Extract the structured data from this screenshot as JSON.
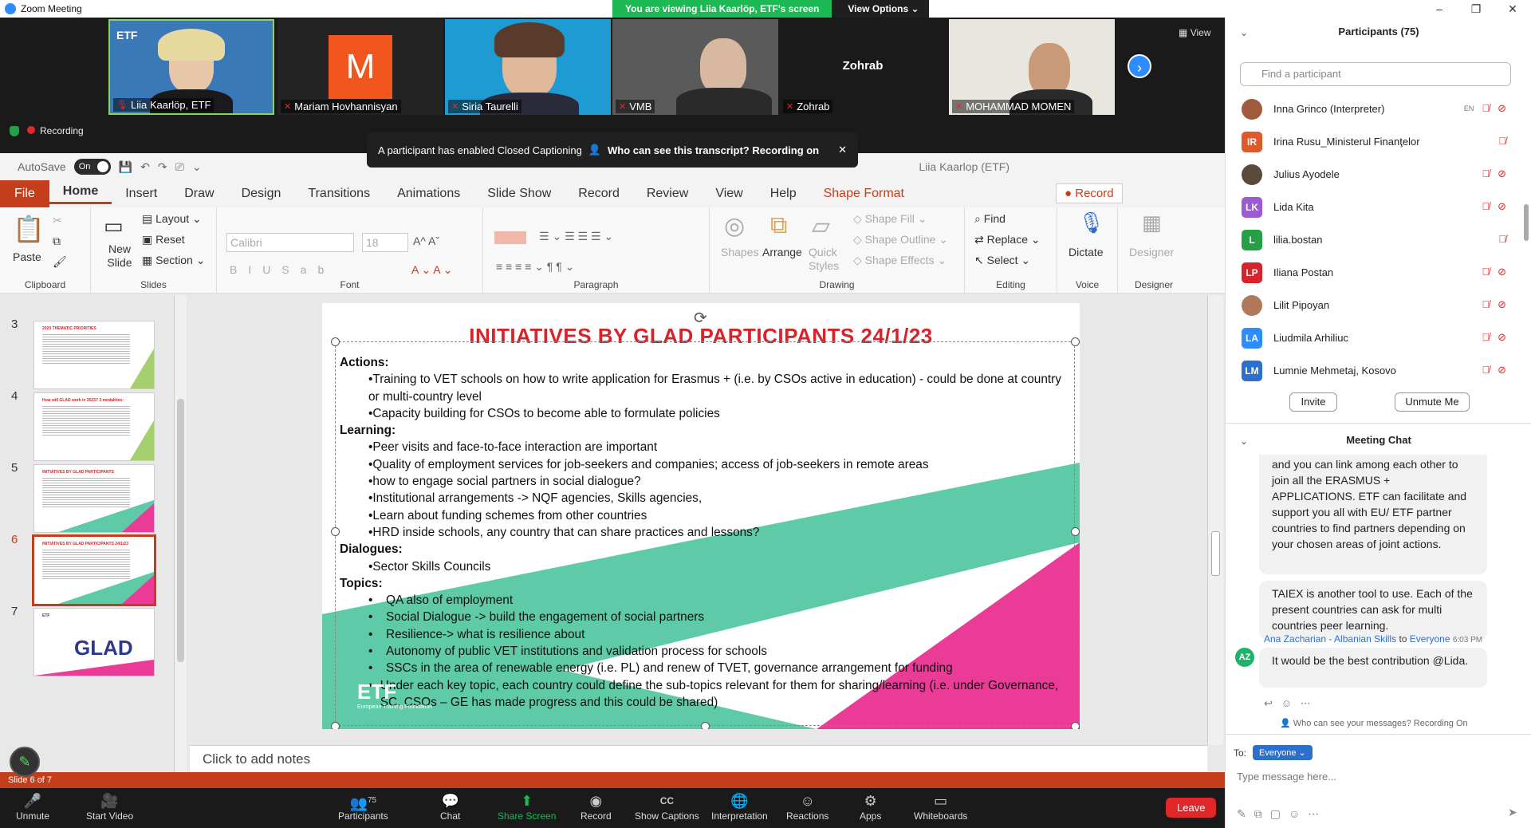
{
  "window": {
    "title": "Zoom Meeting",
    "viewing_banner": "You are viewing Liia Kaarlöp, ETF's screen",
    "view_options": "View Options",
    "minimize": "–",
    "maximize": "❐",
    "close": "✕"
  },
  "video": {
    "tiles": [
      {
        "name": "Liia Kaarlöp, ETF",
        "type": "video"
      },
      {
        "name": "Mariam Hovhannisyan",
        "type": "avatar",
        "initial": "M"
      },
      {
        "name": "Siria Taurelli",
        "type": "video"
      },
      {
        "name": "VMB",
        "type": "video"
      },
      {
        "name": "Zohrab",
        "type": "name",
        "center_label": "Zohrab"
      },
      {
        "name": "MOHAMMAD MOMEN",
        "type": "video"
      }
    ],
    "view_label": "View",
    "recording_label": "Recording"
  },
  "cc_banner": {
    "text": "A participant has enabled Closed Captioning",
    "question": "Who can see this transcript? Recording on"
  },
  "ppt": {
    "autosave_label": "AutoSave",
    "autosave_state": "On",
    "user": "Liia Kaarlop (ETF)",
    "tabs": [
      "Home",
      "Insert",
      "Draw",
      "Design",
      "Transitions",
      "Animations",
      "Slide Show",
      "Record",
      "Review",
      "View",
      "Help"
    ],
    "file_tab": "File",
    "shape_format_tab": "Shape Format",
    "record_button": "Record",
    "ribbon": {
      "paste": "Paste",
      "clipboard": "Clipboard",
      "new_slide": "New Slide",
      "layout": "Layout",
      "reset": "Reset",
      "section": "Section",
      "slides": "Slides",
      "font_name": "Calibri",
      "font_size": "18",
      "font": "Font",
      "paragraph": "Paragraph",
      "shapes": "Shapes",
      "arrange": "Arrange",
      "quick_styles": "Quick Styles",
      "shape_fill": "Shape Fill",
      "shape_outline": "Shape Outline",
      "shape_effects": "Shape Effects",
      "drawing": "Drawing",
      "find": "Find",
      "replace": "Replace",
      "select": "Select",
      "editing": "Editing",
      "dictate": "Dictate",
      "voice": "Voice",
      "designer": "Designer",
      "designer_group": "Designer"
    },
    "thumbnails": [
      {
        "num": "3",
        "title": "2023 THEMATIC PRIORITIES"
      },
      {
        "num": "4",
        "title": "How will GLAD work in 2023? 3 modalities:"
      },
      {
        "num": "5",
        "title": "INITIATIVES BY GLAD PARTICIPANTS"
      },
      {
        "num": "6",
        "title": "INITIATIVES BY GLAD PARTICIPANTS 24/1/23"
      },
      {
        "num": "7",
        "title": "GLAD"
      }
    ],
    "slide": {
      "title": "INITIATIVES BY GLAD PARTICIPANTS 24/1/23",
      "sections": [
        {
          "header": "Actions:",
          "style": "dot",
          "items": [
            "•Training to VET schools on how to write application for Erasmus + (i.e. by CSOs active in education) - could be done at country or multi-country level",
            "•Capacity building for CSOs to become able to formulate policies"
          ]
        },
        {
          "header": "Learning:",
          "style": "dot",
          "items": [
            "•Peer visits and face-to-face interaction are important",
            "•Quality of employment services for job-seekers and companies; access of job-seekers in remote areas",
            "•how to engage social partners in social dialogue?",
            "•Institutional arrangements -> NQF agencies, Skills agencies,",
            "•Learn about funding schemes from other countries",
            "•HRD inside schools, any country that can share practices and lessons?"
          ]
        },
        {
          "header": "Dialogues:",
          "style": "dot",
          "items": [
            "•Sector Skills Councils"
          ]
        },
        {
          "header": "Topics:",
          "style": "bullet",
          "items": [
            " QA also of employment",
            "Social Dialogue -> build the engagement of social partners",
            "Resilience-> what is resilience about",
            "Autonomy of public VET institutions and validation process for schools",
            "SSCs in the area of renewable energy (i.e. PL) and renew of TVET, governance arrangement for funding",
            "Under each key topic, each country could define the sub-topics relevant for them for sharing/learning (i.e. under Governance, SC, CSOs – GE has made progress and this could be shared)"
          ]
        }
      ],
      "logo_text": "ETF",
      "logo_sub": "European Training Foundation"
    },
    "notes_placeholder": "Click to add notes",
    "status_left": "Slide 6 of 7"
  },
  "bottombar": {
    "items": [
      {
        "label": "Unmute",
        "icon": "mic-off-icon",
        "glyph": "🎤"
      },
      {
        "label": "Start Video",
        "icon": "video-off-icon",
        "glyph": "🎥"
      },
      {
        "label": "Participants",
        "icon": "participants-icon",
        "glyph": "👥",
        "count": "75"
      },
      {
        "label": "Chat",
        "icon": "chat-icon",
        "glyph": "💬"
      },
      {
        "label": "Share Screen",
        "icon": "share-screen-icon",
        "glyph": "⬆"
      },
      {
        "label": "Record",
        "icon": "record-icon",
        "glyph": "◉"
      },
      {
        "label": "Show Captions",
        "icon": "captions-icon",
        "glyph": "CC"
      },
      {
        "label": "Interpretation",
        "icon": "globe-icon",
        "glyph": "🌐"
      },
      {
        "label": "Reactions",
        "icon": "reactions-icon",
        "glyph": "☺"
      },
      {
        "label": "Apps",
        "icon": "apps-icon",
        "glyph": "⚙"
      },
      {
        "label": "Whiteboards",
        "icon": "whiteboard-icon",
        "glyph": "▭"
      }
    ],
    "leave": "Leave"
  },
  "participants": {
    "title": "Participants (75)",
    "search_placeholder": "Find a participant",
    "list": [
      {
        "name": "Inna Grinco (Interpreter)",
        "initials": "",
        "color": "#a05a3c",
        "photo": true,
        "en": "EN",
        "video_off": true
      },
      {
        "name": "Irina Rusu_Ministerul Finanţelor",
        "initials": "IR",
        "color": "#e0592a",
        "photo": false,
        "en": "",
        "video_off": false
      },
      {
        "name": "Julius Ayodele",
        "initials": "",
        "color": "#5a4a3a",
        "photo": true,
        "en": "",
        "video_off": true
      },
      {
        "name": "Lida Kita",
        "initials": "LK",
        "color": "#9c5bd4",
        "photo": false,
        "en": "",
        "video_off": true
      },
      {
        "name": "lilia.bostan",
        "initials": "L",
        "color": "#26a046",
        "photo": false,
        "en": "",
        "video_off": false
      },
      {
        "name": "Iliana Postan",
        "initials": "LP",
        "color": "#d8232a",
        "photo": false,
        "en": "",
        "video_off": true
      },
      {
        "name": "Lilit Pipoyan",
        "initials": "",
        "color": "#b07a5a",
        "photo": true,
        "en": "",
        "video_off": true
      },
      {
        "name": "Liudmila Arhiliuc",
        "initials": "LA",
        "color": "#2d8cff",
        "photo": false,
        "en": "",
        "video_off": true
      },
      {
        "name": "Lumnie Mehmetaj, Kosovo",
        "initials": "LM",
        "color": "#2d6fcc",
        "photo": false,
        "en": "",
        "video_off": true
      }
    ],
    "invite": "Invite",
    "unmute_me": "Unmute Me"
  },
  "chat": {
    "title": "Meeting Chat",
    "messages": [
      "and you can link among each other to join all the ERASMUS + APPLICATIONS. ETF can facilitate and support you all with EU/ ETF partner countries to find partners depending on your chosen areas of joint actions.",
      "TAIEX is another tool to use. Each of the present countries can ask for multi countries peer learning.",
      "It would be the best contribution @Lida."
    ],
    "last_sender": "Ana Zacharian - Albanian Skills",
    "to_word": "to",
    "recipient": "Everyone",
    "time": "6:03 PM",
    "sender_initials": "AZ",
    "who_can_see": "Who can see your messages? Recording On",
    "to_label": "To:",
    "to_select": "Everyone",
    "input_placeholder": "Type message here..."
  }
}
